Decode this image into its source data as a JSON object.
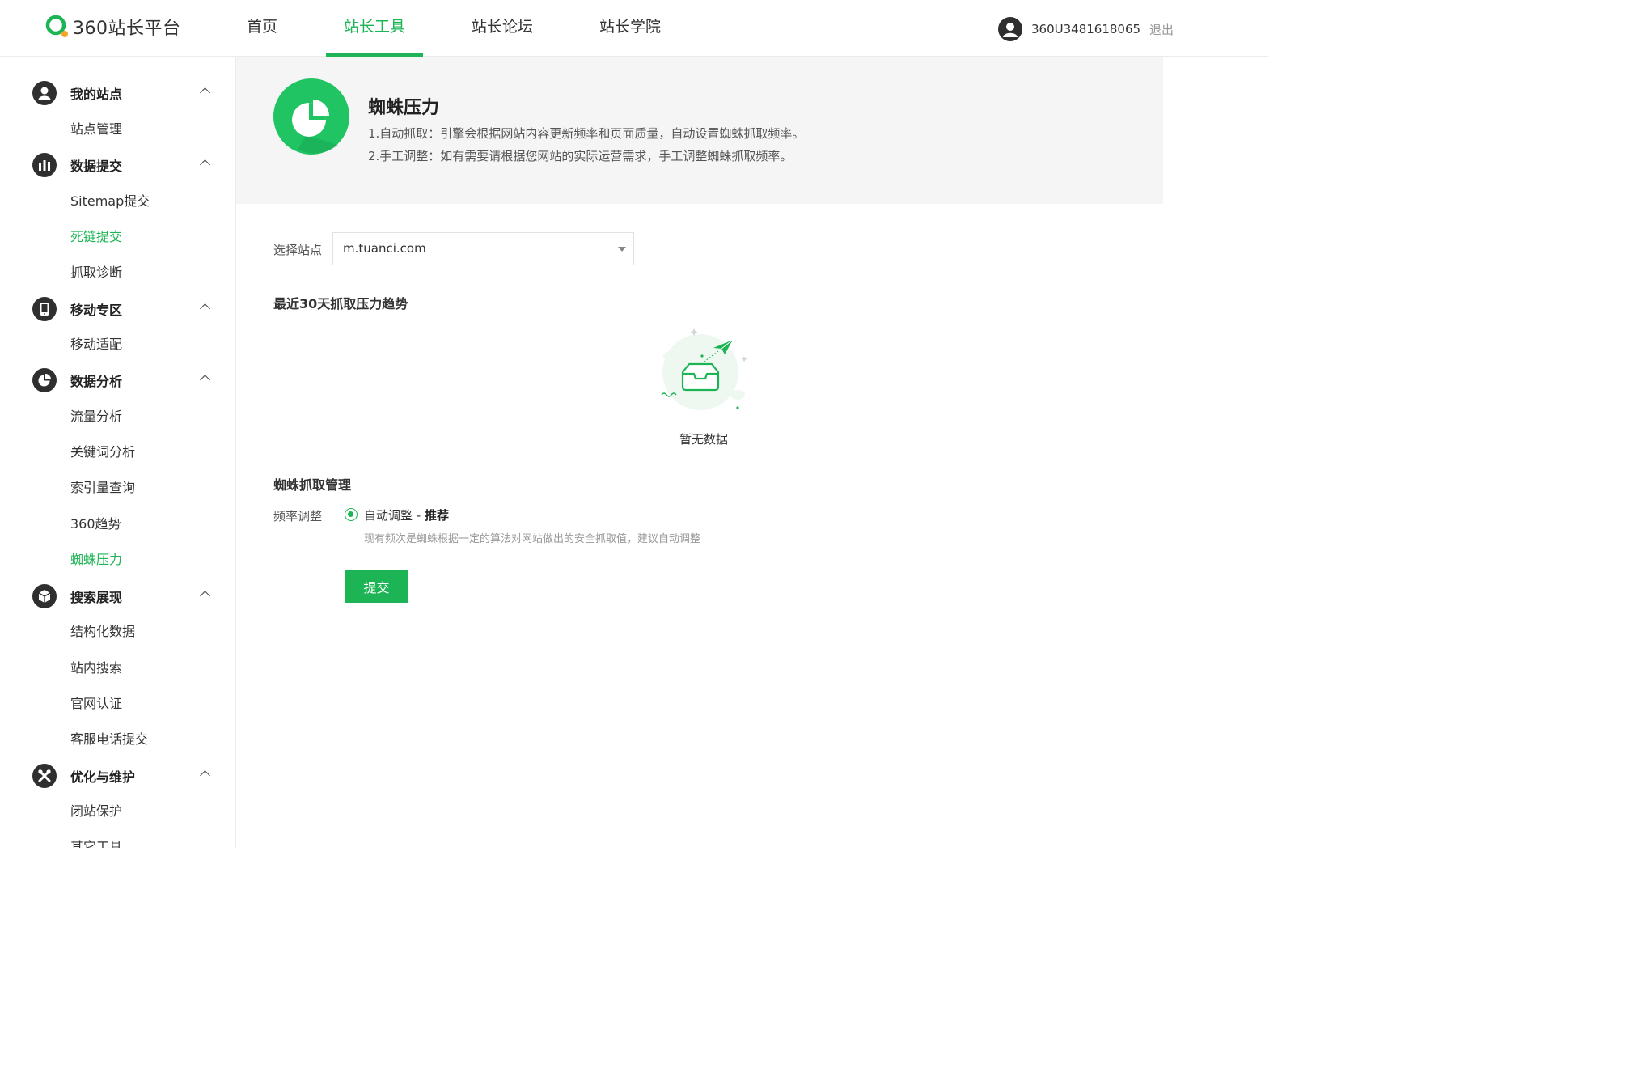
{
  "header": {
    "logo_text": "360站长平台",
    "nav": [
      {
        "label": "首页",
        "active": false
      },
      {
        "label": "站长工具",
        "active": true
      },
      {
        "label": "站长论坛",
        "active": false
      },
      {
        "label": "站长学院",
        "active": false
      }
    ],
    "user": {
      "name": "360U3481618065",
      "logout": "退出"
    }
  },
  "sidebar": {
    "groups": [
      {
        "label": "我的站点",
        "icon": "user-icon",
        "items": [
          {
            "label": "站点管理",
            "active": false
          }
        ]
      },
      {
        "label": "数据提交",
        "icon": "bar-chart-icon",
        "items": [
          {
            "label": "Sitemap提交",
            "active": false
          },
          {
            "label": "死链提交",
            "active": true
          },
          {
            "label": "抓取诊断",
            "active": false
          }
        ]
      },
      {
        "label": "移动专区",
        "icon": "mobile-icon",
        "items": [
          {
            "label": "移动适配",
            "active": false
          }
        ]
      },
      {
        "label": "数据分析",
        "icon": "pie-chart-icon",
        "items": [
          {
            "label": "流量分析",
            "active": false
          },
          {
            "label": "关键词分析",
            "active": false
          },
          {
            "label": "索引量查询",
            "active": false
          },
          {
            "label": "360趋势",
            "active": false
          },
          {
            "label": "蜘蛛压力",
            "active": true
          }
        ]
      },
      {
        "label": "搜索展现",
        "icon": "cube-icon",
        "items": [
          {
            "label": "结构化数据",
            "active": false
          },
          {
            "label": "站内搜索",
            "active": false
          },
          {
            "label": "官网认证",
            "active": false
          },
          {
            "label": "客服电话提交",
            "active": false
          }
        ]
      },
      {
        "label": "优化与维护",
        "icon": "tools-icon",
        "items": [
          {
            "label": "闭站保护",
            "active": false
          },
          {
            "label": "其它工具",
            "active": false
          }
        ]
      }
    ]
  },
  "banner": {
    "title": "蜘蛛压力",
    "desc1": "1.自动抓取：引擎会根据网站内容更新频率和页面质量，自动设置蜘蛛抓取频率。",
    "desc2": "2.手工调整：如有需要请根据您网站的实际运营需求，手工调整蜘蛛抓取频率。"
  },
  "site_select": {
    "label": "选择站点",
    "value": "m.tuanci.com"
  },
  "trend": {
    "title": "最近30天抓取压力趋势",
    "empty_text": "暂无数据"
  },
  "manage": {
    "title": "蜘蛛抓取管理",
    "freq_label": "频率调整",
    "option_text": "自动调整 - ",
    "option_bold": "推荐",
    "hint": "现有频次是蜘蛛根据一定的算法对网站做出的安全抓取值，建议自动调整",
    "submit": "提交"
  },
  "colors": {
    "accent": "#1cb454",
    "banner_bg": "#f5f5f5",
    "icon_dark": "#2f2f2f"
  }
}
